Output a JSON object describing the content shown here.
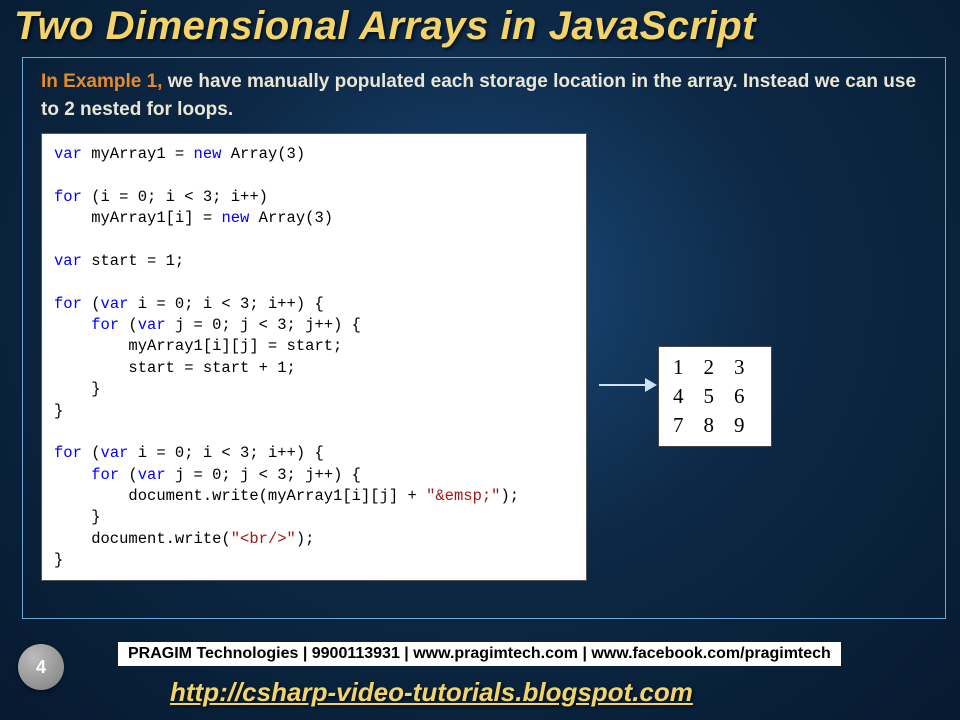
{
  "title": "Two Dimensional Arrays in JavaScript",
  "intro": {
    "prefix": "In Example 1,",
    "rest": " we have manually populated each storage location in the array. Instead we can use to 2 nested for loops."
  },
  "code": {
    "l01a": "var",
    "l01b": " myArray1 = ",
    "l01c": "new",
    "l01d": " Array(3)",
    "l02": "",
    "l03a": "for",
    "l03b": " (i = 0; i < 3; i++)",
    "l04a": "    myArray1[i] = ",
    "l04b": "new",
    "l04c": " Array(3)",
    "l05": "",
    "l06a": "var",
    "l06b": " start = 1;",
    "l07": "",
    "l08a": "for",
    "l08b": " (",
    "l08c": "var",
    "l08d": " i = 0; i < 3; i++) {",
    "l09a": "    ",
    "l09b": "for",
    "l09c": " (",
    "l09d": "var",
    "l09e": " j = 0; j < 3; j++) {",
    "l10": "        myArray1[i][j] = start;",
    "l11": "        start = start + 1;",
    "l12": "    }",
    "l13": "}",
    "l14": "",
    "l15a": "for",
    "l15b": " (",
    "l15c": "var",
    "l15d": " i = 0; i < 3; i++) {",
    "l16a": "    ",
    "l16b": "for",
    "l16c": " (",
    "l16d": "var",
    "l16e": " j = 0; j < 3; j++) {",
    "l17a": "        document.write(myArray1[i][j] + ",
    "l17b": "\"&emsp;\"",
    "l17c": ");",
    "l18": "    }",
    "l19a": "    document.write(",
    "l19b": "\"<br/>\"",
    "l19c": ");",
    "l20": "}"
  },
  "output": {
    "rows": [
      [
        "1",
        "2",
        "3"
      ],
      [
        "4",
        "5",
        "6"
      ],
      [
        "7",
        "8",
        "9"
      ]
    ]
  },
  "page_number": "4",
  "banner": "PRAGIM Technologies | 9900113931 | www.pragimtech.com | www.facebook.com/pragimtech",
  "blog_url": "http://csharp-video-tutorials.blogspot.com"
}
